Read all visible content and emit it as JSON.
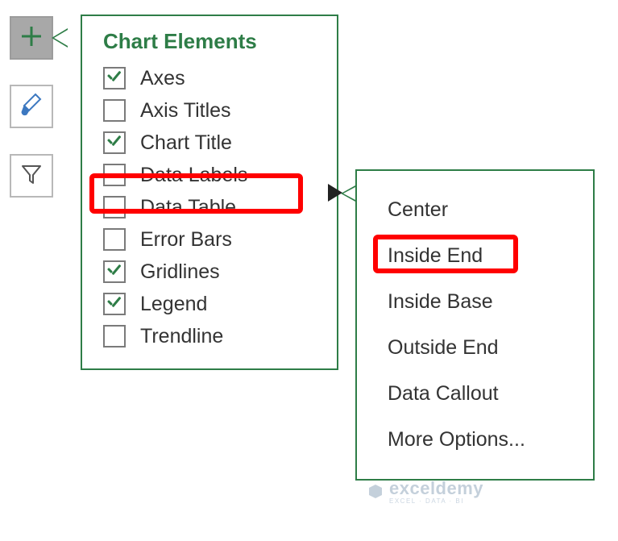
{
  "panel": {
    "title": "Chart Elements",
    "items": [
      {
        "label": "Axes",
        "checked": true
      },
      {
        "label": "Axis Titles",
        "checked": false
      },
      {
        "label": "Chart Title",
        "checked": true
      },
      {
        "label": "Data Labels",
        "checked": false
      },
      {
        "label": "Data Table",
        "checked": false
      },
      {
        "label": "Error Bars",
        "checked": false
      },
      {
        "label": "Gridlines",
        "checked": true
      },
      {
        "label": "Legend",
        "checked": true
      },
      {
        "label": "Trendline",
        "checked": false
      }
    ]
  },
  "submenu": {
    "items": [
      {
        "label": "Center"
      },
      {
        "label": "Inside End"
      },
      {
        "label": "Inside Base"
      },
      {
        "label": "Outside End"
      },
      {
        "label": "Data Callout"
      },
      {
        "label": "More Options..."
      }
    ]
  },
  "watermark": {
    "brand": "exceldemy",
    "tag": "EXCEL · DATA · BI"
  }
}
